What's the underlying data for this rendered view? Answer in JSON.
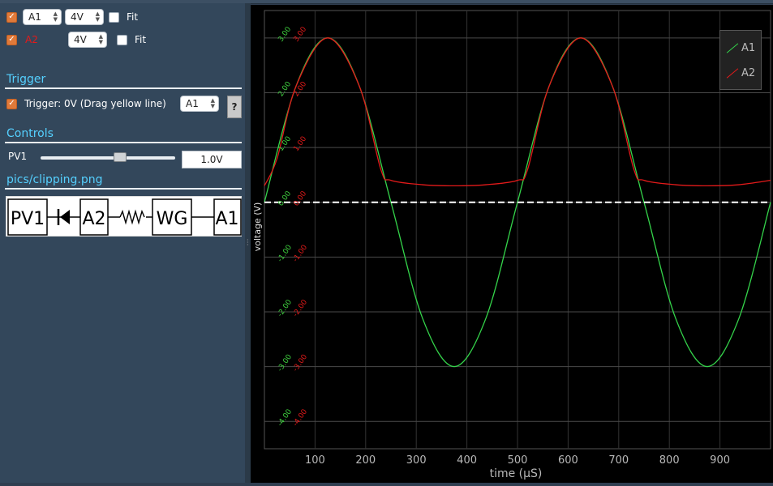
{
  "channels": [
    {
      "enabled": true,
      "name": "A1",
      "name_color": "#ffffff",
      "range": "4V",
      "fit_label": "Fit",
      "fit_checked": false,
      "has_selector": true
    },
    {
      "enabled": true,
      "name": "A2",
      "name_color": "#e31a1a",
      "range": "4V",
      "fit_label": "Fit",
      "fit_checked": false,
      "has_selector": false
    }
  ],
  "trigger": {
    "header": "Trigger",
    "enabled": true,
    "label": "Trigger: 0V (Drag yellow line)",
    "source": "A1",
    "help_label": "?"
  },
  "controls": {
    "header": "Controls",
    "slider_label": "PV1",
    "slider_fraction": 0.6,
    "value": "1.0V"
  },
  "image_section": {
    "header": "pics/clipping.png",
    "labels": [
      "PV1",
      "A2",
      "WG",
      "A1"
    ]
  },
  "plot": {
    "xlabel": "time (µS)",
    "ylabel": "voltage (V)",
    "legend": [
      {
        "name": "A1",
        "color": "#34d34a"
      },
      {
        "name": "A2",
        "color": "#e31a1a"
      }
    ]
  },
  "chart_data": {
    "type": "line",
    "xlabel": "time (µS)",
    "ylabel": "voltage (V)",
    "xlim": [
      0,
      1000
    ],
    "ylim": [
      -4.5,
      3.5
    ],
    "x_ticks": [
      100,
      200,
      300,
      400,
      500,
      600,
      700,
      800,
      900
    ],
    "x_tick_labels": [
      "100",
      "200",
      "300",
      "400",
      "500",
      "600",
      "700",
      "800",
      "900"
    ],
    "y_ticks": [
      3,
      2,
      1,
      0,
      -1,
      -2,
      -3,
      -4
    ],
    "y_tick_labels_a1": [
      "3.00",
      "2.00",
      "1.00",
      "0.00",
      "-1.00",
      "-2.00",
      "-3.00",
      "-4.00"
    ],
    "y_tick_labels_a2": [
      "3.00",
      "2.00",
      "1.00",
      "0.00",
      "-1.00",
      "-2.00",
      "-3.00",
      "-4.00"
    ],
    "trigger_level": 0,
    "grid": true,
    "legend_position": "top-right",
    "series": [
      {
        "name": "A1",
        "color": "#34d34a",
        "x": [
          0,
          62.5,
          125,
          187.5,
          250,
          312.5,
          375,
          437.5,
          500,
          562.5,
          625,
          687.5,
          750,
          812.5,
          875,
          937.5,
          1000
        ],
        "y": [
          0.0,
          2.12,
          3.0,
          2.12,
          0.0,
          -2.12,
          -3.0,
          -2.12,
          0.0,
          2.12,
          3.0,
          2.12,
          0.0,
          -2.12,
          -3.0,
          -2.12,
          0.0
        ]
      },
      {
        "name": "A2",
        "color": "#e31a1a",
        "x": [
          0,
          25,
          62.5,
          125,
          187.5,
          230,
          250,
          312.5,
          375,
          437.5,
          500,
          520,
          562.5,
          625,
          687.5,
          730,
          750,
          812.5,
          875,
          937.5,
          1000
        ],
        "y": [
          0.3,
          0.8,
          2.12,
          3.0,
          2.12,
          0.6,
          0.4,
          0.32,
          0.3,
          0.32,
          0.4,
          0.6,
          2.12,
          3.0,
          2.12,
          0.6,
          0.4,
          0.32,
          0.3,
          0.32,
          0.4
        ]
      }
    ]
  }
}
